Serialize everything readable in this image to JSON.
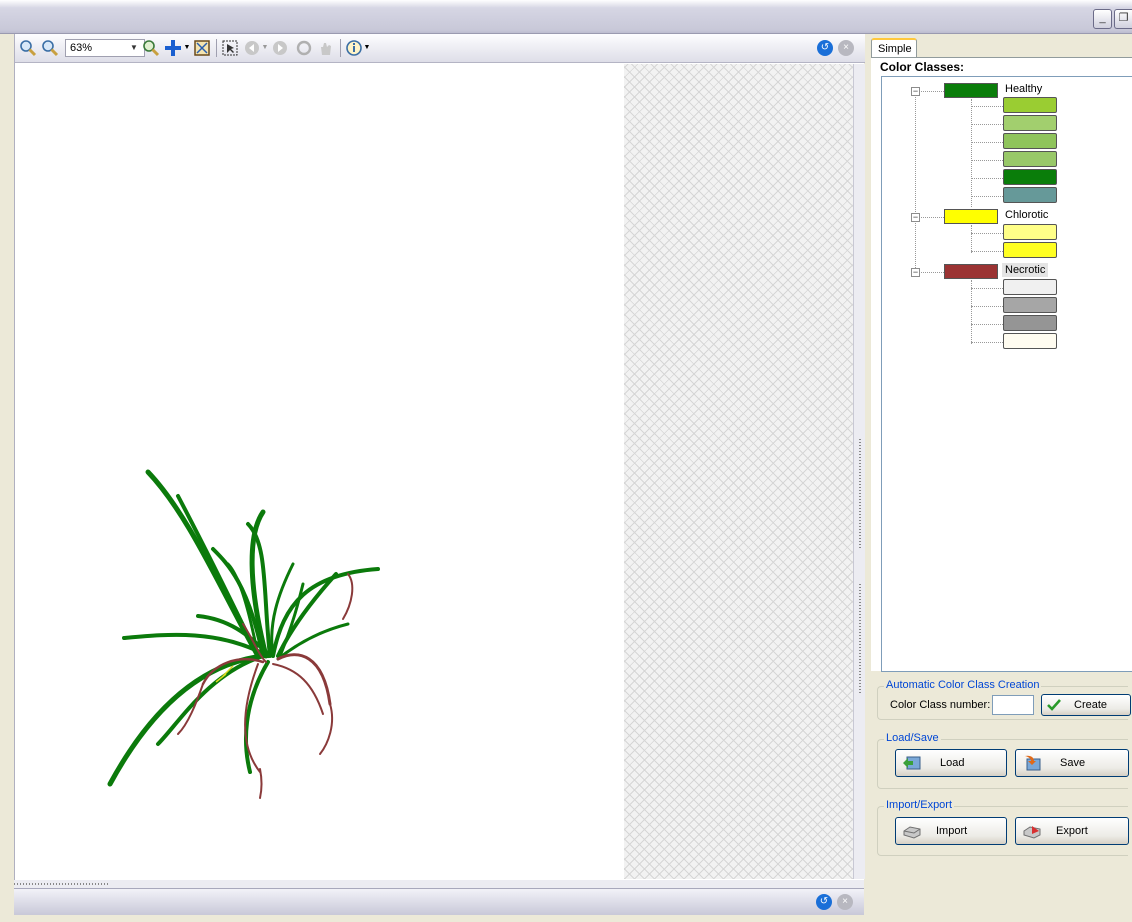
{
  "window": {
    "minimize_glyph": "_",
    "restore_glyph": "❐"
  },
  "viewer": {
    "toolbar": {
      "zoom_value": "63%",
      "icons": [
        "zoom-in-icon",
        "zoom-out-icon",
        "zoom-icon",
        "pan-icon",
        "fit-icon",
        "select-icon",
        "back-icon",
        "forward-icon",
        "refresh-icon",
        "hand-icon",
        "info-icon"
      ]
    }
  },
  "panel": {
    "tab_label": "Simple",
    "color_classes_label": "Color Classes:",
    "classes": [
      {
        "name": "Healthy",
        "color": "#0a7d0a",
        "children": [
          "#9acd32",
          "#a2cf6e",
          "#8fc45b",
          "#98c868",
          "#0a7d0a",
          "#669999"
        ]
      },
      {
        "name": "Chlorotic",
        "color": "#ffff00",
        "children": [
          "#ffff88",
          "#ffff22"
        ]
      },
      {
        "name": "Necrotic",
        "color": "#9b3333",
        "children": [
          "#f0f0f0",
          "#a6a6a6",
          "#959595",
          "#fffcf0"
        ]
      }
    ],
    "auto_creation": {
      "legend": "Automatic Color Class Creation",
      "number_label": "Color Class number:",
      "number_value": "",
      "create_label": "Create"
    },
    "load_save": {
      "legend": "Load/Save",
      "load_label": "Load",
      "save_label": "Save"
    },
    "import_export": {
      "legend": "Import/Export",
      "import_label": "Import",
      "export_label": "Export"
    }
  }
}
